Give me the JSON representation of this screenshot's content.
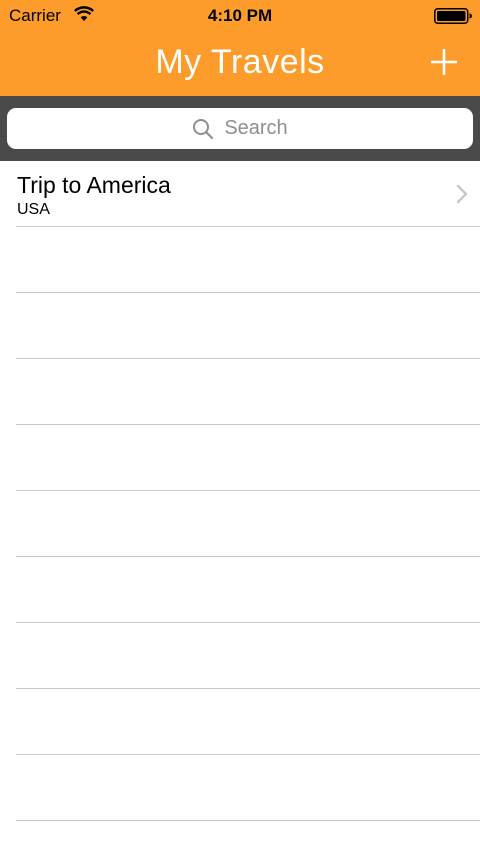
{
  "status_bar": {
    "carrier": "Carrier",
    "time": "4:10 PM"
  },
  "nav": {
    "title": "My Travels",
    "add_icon": "plus-icon"
  },
  "search": {
    "placeholder": "Search",
    "icon": "magnifier-icon"
  },
  "trips": [
    {
      "title": "Trip to America",
      "subtitle": "USA"
    }
  ],
  "colors": {
    "accent": "#fd9c2a",
    "search_background": "#4a4a4a",
    "separator": "#c8c7cc"
  }
}
